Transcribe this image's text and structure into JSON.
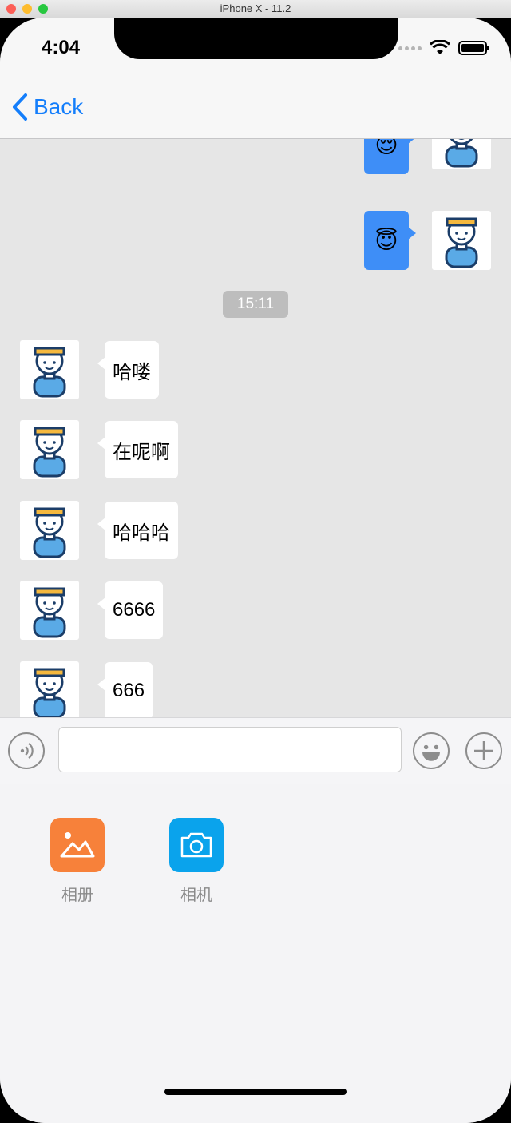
{
  "window": {
    "title": "iPhone X - 11.2"
  },
  "status": {
    "time": "4:04"
  },
  "nav": {
    "back_label": "Back"
  },
  "chat": {
    "outgoing": [
      {
        "emoji": "😌"
      },
      {
        "emoji": "😇"
      }
    ],
    "timestamp": "15:11",
    "incoming": [
      {
        "text": "哈喽"
      },
      {
        "text": "在呢啊"
      },
      {
        "text": "哈哈哈"
      },
      {
        "text": "6666"
      },
      {
        "text": "666"
      }
    ]
  },
  "input": {
    "value": "",
    "placeholder": ""
  },
  "panel": {
    "album_label": "相册",
    "camera_label": "相机"
  },
  "colors": {
    "accent": "#147efb",
    "outgoing_bubble": "#3e8ef7",
    "album_icon": "#f7813a",
    "camera_icon": "#0aa3ec"
  }
}
